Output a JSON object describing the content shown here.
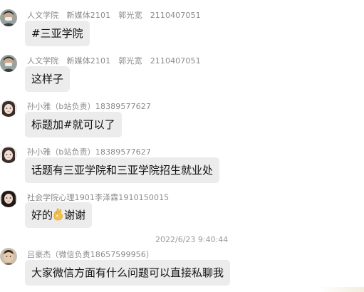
{
  "messages": [
    {
      "sender": "人文学院　新媒体2101　郭光宽　2110407051",
      "text": "#三亚学院",
      "avatar": "avatar-man-mask"
    },
    {
      "sender": "人文学院　新媒体2101　郭光宽　2110407051",
      "text": "这样子",
      "avatar": "avatar-man-mask"
    },
    {
      "sender": "孙小雅（b站负责）18389577627",
      "text": "标题加#就可以了",
      "avatar": "avatar-girl"
    },
    {
      "sender": "孙小雅（b站负责）18389577627",
      "text": "话题有三亚学院和三亚学院招生就业处",
      "avatar": "avatar-girl"
    },
    {
      "sender": "社会学院心理1901李泽霖1910150015",
      "text_before": "好的",
      "emoji": "ok-hand-emoji",
      "text_after": "谢谢",
      "avatar": "avatar-woman"
    },
    {
      "sender": "吕豪杰（微信负责18657599956）",
      "text": "大家微信方面有什么问题可以直接私聊我",
      "avatar": "avatar-boy"
    }
  ],
  "timestamp": "2022/6/23 9:40:44",
  "colors": {
    "bubble": "#ececec",
    "meta_text": "#8a8a8a",
    "background": "#ffffff"
  }
}
